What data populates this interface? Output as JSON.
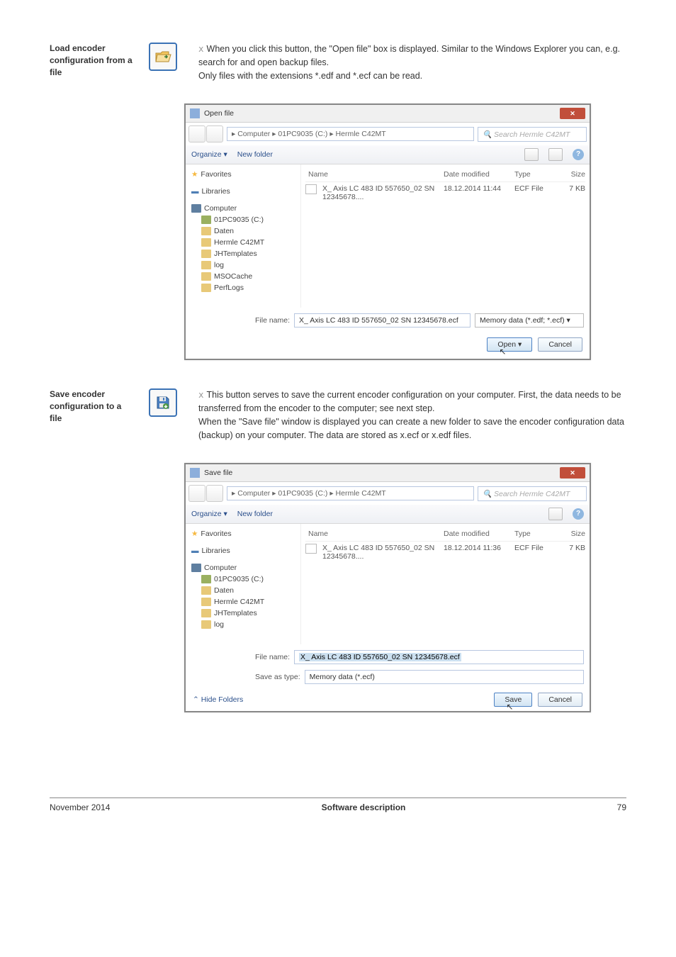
{
  "section1": {
    "label": "Load encoder configuration from a file",
    "text": "When you click this button, the \"Open file\" box is displayed. Similar to the Windows Explorer you can, e.g. search for and open backup files.\nOnly files with the extensions *.edf and *.ecf can be read."
  },
  "section2": {
    "label": "Save encoder configuration to a file",
    "text": "This button serves to save the current encoder configuration on your computer. First, the data needs to be transferred from the encoder to the computer; see next step.\nWhen the \"Save file\" window is displayed you can create a new folder to save the encoder configuration data (backup) on your computer. The data are stored as x.ecf or x.edf files."
  },
  "openDialog": {
    "title": "Open file",
    "path": "▸ Computer ▸ 01PC9035 (C:) ▸ Hermle C42MT",
    "searchPlaceholder": "Search Hermle C42MT",
    "organize": "Organize ▾",
    "newFolder": "New folder",
    "headers": {
      "name": "Name",
      "date": "Date modified",
      "type": "Type",
      "size": "Size"
    },
    "file": {
      "name": "X_ Axis LC 483 ID 557650_02 SN 12345678....",
      "date": "18.12.2014 11:44",
      "type": "ECF File",
      "size": "7 KB"
    },
    "nav": {
      "favorites": "Favorites",
      "libraries": "Libraries",
      "computer": "Computer",
      "drive": "01PC9035 (C:)",
      "folders": [
        "Daten",
        "Hermle C42MT",
        "JHTemplates",
        "log",
        "MSOCache",
        "PerfLogs"
      ]
    },
    "fileNameLabel": "File name:",
    "fileNameValue": "X_ Axis LC 483 ID 557650_02 SN 12345678.ecf",
    "filter": "Memory data (*.edf; *.ecf)",
    "openBtn": "Open",
    "cancelBtn": "Cancel"
  },
  "saveDialog": {
    "title": "Save file",
    "path": "▸ Computer ▸ 01PC9035 (C:) ▸ Hermle C42MT",
    "searchPlaceholder": "Search Hermle C42MT",
    "organize": "Organize ▾",
    "newFolder": "New folder",
    "headers": {
      "name": "Name",
      "date": "Date modified",
      "type": "Type",
      "size": "Size"
    },
    "file": {
      "name": "X_ Axis LC 483 ID 557650_02 SN 12345678....",
      "date": "18.12.2014 11:36",
      "type": "ECF File",
      "size": "7 KB"
    },
    "nav": {
      "favorites": "Favorites",
      "libraries": "Libraries",
      "computer": "Computer",
      "drive": "01PC9035 (C:)",
      "folders": [
        "Daten",
        "Hermle C42MT",
        "JHTemplates",
        "log"
      ]
    },
    "fileNameLabel": "File name:",
    "fileNameValue": "X_ Axis LC 483 ID 557650_02 SN 12345678.ecf",
    "saveTypeLabel": "Save as type:",
    "saveTypeValue": "Memory data (*.ecf)",
    "hideFolders": "Hide Folders",
    "saveBtn": "Save",
    "cancelBtn": "Cancel"
  },
  "footer": {
    "left": "November 2014",
    "center": "Software description",
    "right": "79"
  }
}
